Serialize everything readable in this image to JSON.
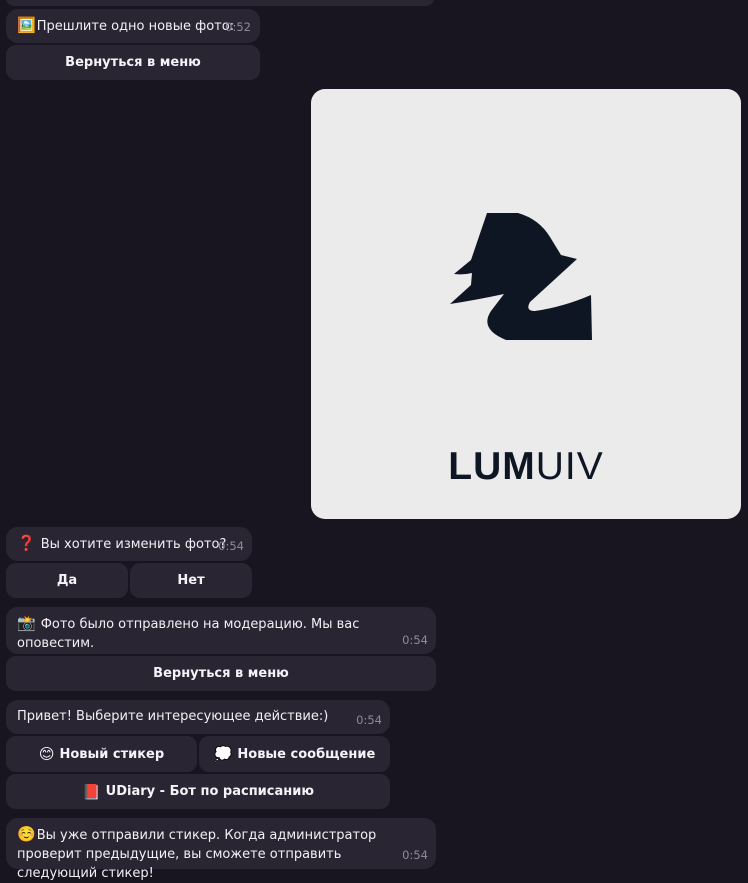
{
  "messages": [
    {
      "emoji": "🖼️",
      "text": "Прешлите одно новые фото:",
      "time": "0:52"
    },
    {
      "emoji": "❓",
      "text": "Вы хотите изменить фото?",
      "time": "0:54"
    },
    {
      "emoji": "📸",
      "text": "Фото было отправлено на модерацию. Мы вас оповестим.",
      "time": "0:54"
    },
    {
      "text": "Привет! Выберите интересующее действие:)",
      "time": "0:54"
    },
    {
      "emoji": "☺️",
      "text": "Вы уже отправили стикер. Когда администратор проверит предыдущие, вы сможете отправить следующий стикер!",
      "time": "0:54"
    }
  ],
  "buttons": {
    "back_menu_1": "Вернуться в меню",
    "yes": "Да",
    "no": "Нет",
    "back_menu_2": "Вернуться в меню",
    "new_sticker_emoji": "😊",
    "new_sticker": "Новый стикер",
    "new_message_emoji": "💭",
    "new_message": "Новые сообщение",
    "udiary_emoji": "📕",
    "udiary": "UDiary - Бот по расписанию"
  },
  "photo": {
    "logo_bold": "LUM",
    "logo_light": "UIV"
  },
  "colors": {
    "background": "#181520",
    "bubble": "#2a2533",
    "logo": "#0f1623",
    "photo_bg": "#ebebeb"
  }
}
